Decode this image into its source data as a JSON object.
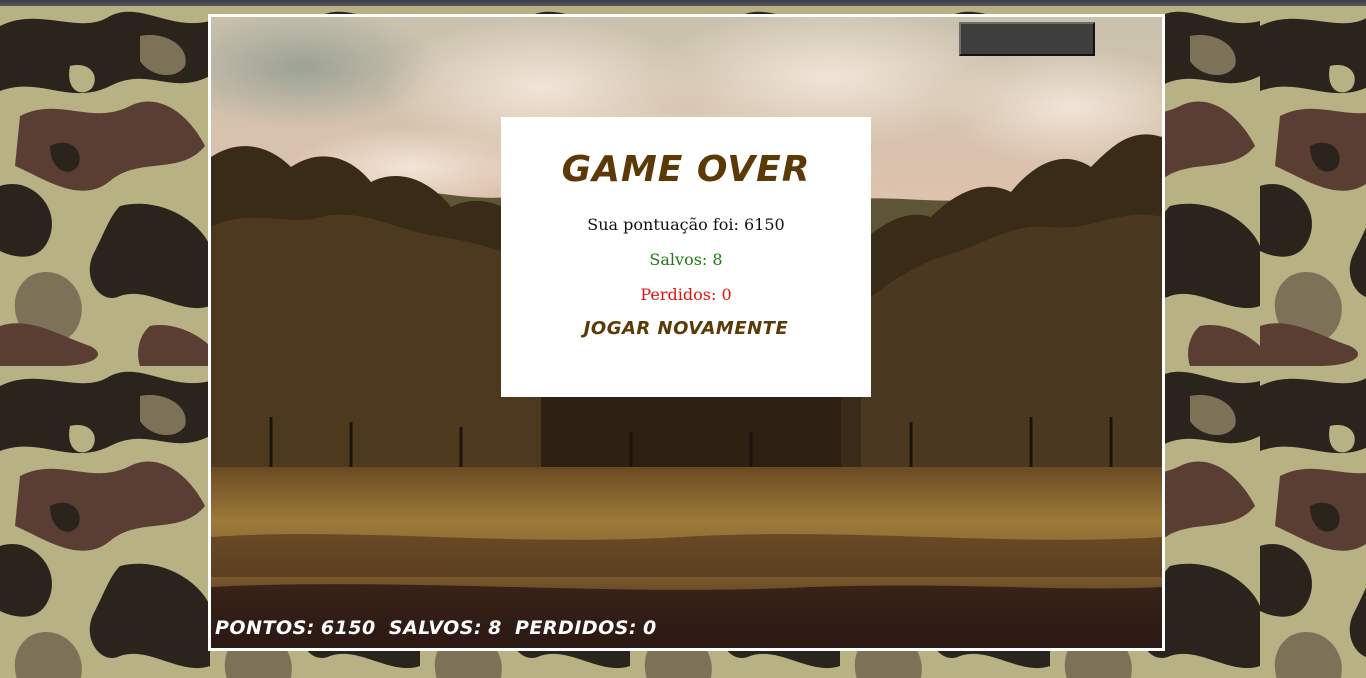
{
  "game_over": {
    "title": "GAME OVER",
    "score_text": "Sua pontuação foi: 6150",
    "saved_text": "Salvos: 8",
    "lost_text": "Perdidos: 0",
    "play_again_label": "JOGAR NOVAMENTE"
  },
  "hud": {
    "points_label": "PONTOS:",
    "points_value": "6150",
    "saved_label": "SALVOS:",
    "saved_value": "8",
    "lost_label": "PERDIDOS:",
    "lost_value": "0"
  },
  "colors": {
    "title_brown": "#5c3a08",
    "saved_green": "#1f7a13",
    "lost_red": "#e0140e",
    "camo_light": "#b7b183",
    "camo_dark": "#2b241d",
    "camo_brown": "#5a3e33",
    "camo_olive": "#7d7258"
  }
}
